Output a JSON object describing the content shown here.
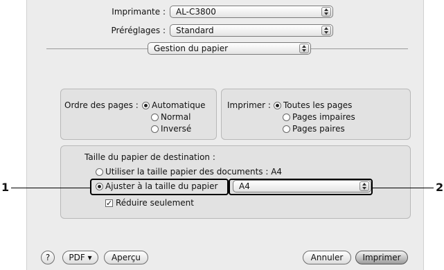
{
  "printer": {
    "label": "Imprimante :",
    "value": "AL-C3800"
  },
  "presets": {
    "label": "Préréglages :",
    "value": "Standard"
  },
  "panel": {
    "value": "Gestion du papier"
  },
  "page_order": {
    "label": "Ordre des pages :",
    "options": [
      "Automatique",
      "Normal",
      "Inversé"
    ],
    "selected": "Automatique"
  },
  "print": {
    "label": "Imprimer :",
    "options": [
      "Toutes les pages",
      "Pages impaires",
      "Pages paires"
    ],
    "selected": "Toutes les pages"
  },
  "destination": {
    "title": "Taille du papier de destination :",
    "use_doc_size": "Utiliser la taille papier des documents : A4",
    "fit_to_paper": "Ajuster à la taille du papier",
    "paper_value": "A4",
    "reduce_only": "Réduire seulement",
    "reduce_only_checked": true,
    "selected": "fit_to_paper"
  },
  "buttons": {
    "help": "?",
    "pdf": "PDF ▾",
    "preview": "Aperçu",
    "cancel": "Annuler",
    "print": "Imprimer"
  },
  "callouts": {
    "one": "1",
    "two": "2"
  }
}
